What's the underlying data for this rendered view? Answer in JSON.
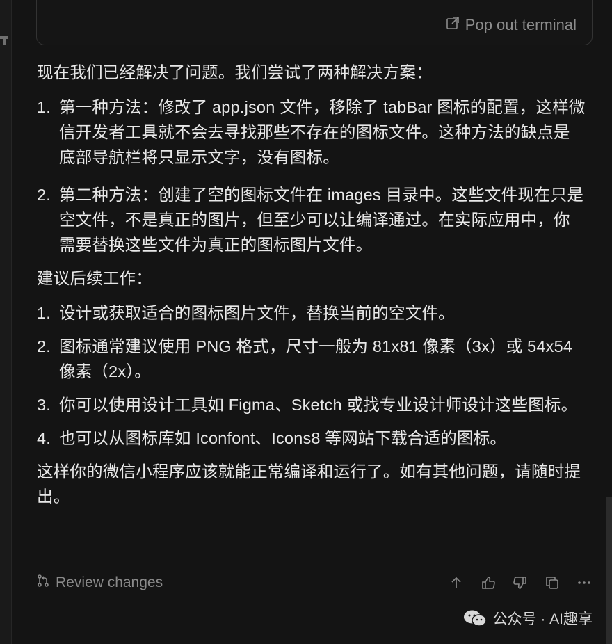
{
  "terminal": {
    "popout_label": "Pop out terminal"
  },
  "content": {
    "intro": "现在我们已经解决了问题。我们尝试了两种解决方案：",
    "solutions": [
      {
        "num": "1.",
        "text": "第一种方法：修改了 app.json 文件，移除了 tabBar 图标的配置，这样微信开发者工具就不会去寻找那些不存在的图标文件。这种方法的缺点是底部导航栏将只显示文字，没有图标。"
      },
      {
        "num": "2.",
        "text": "第二种方法：创建了空的图标文件在 images 目录中。这些文件现在只是空文件，不是真正的图片，但至少可以让编译通过。在实际应用中，你需要替换这些文件为真正的图标图片文件。"
      }
    ],
    "followup_title": "建议后续工作：",
    "followups": [
      {
        "num": "1.",
        "text": "设计或获取适合的图标图片文件，替换当前的空文件。"
      },
      {
        "num": "2.",
        "text": "图标通常建议使用 PNG 格式，尺寸一般为 81x81 像素（3x）或 54x54 像素（2x）。"
      },
      {
        "num": "3.",
        "text": "你可以使用设计工具如 Figma、Sketch 或找专业设计师设计这些图标。"
      },
      {
        "num": "4.",
        "text": "也可以从图标库如 Iconfont、Icons8 等网站下载合适的图标。"
      }
    ],
    "closing": "这样你的微信小程序应该就能正常编译和运行了。如有其他问题，请随时提出。"
  },
  "footer": {
    "review_label": "Review changes",
    "actions": [
      "arrow-up-icon",
      "thumbs-up-icon",
      "thumbs-down-icon",
      "copy-icon",
      "more-icon"
    ]
  },
  "watermark": {
    "text": "公众号 · AI趣享"
  },
  "colors": {
    "background": "#141414",
    "text": "#e8e8e8",
    "muted": "#8a8a8a"
  }
}
